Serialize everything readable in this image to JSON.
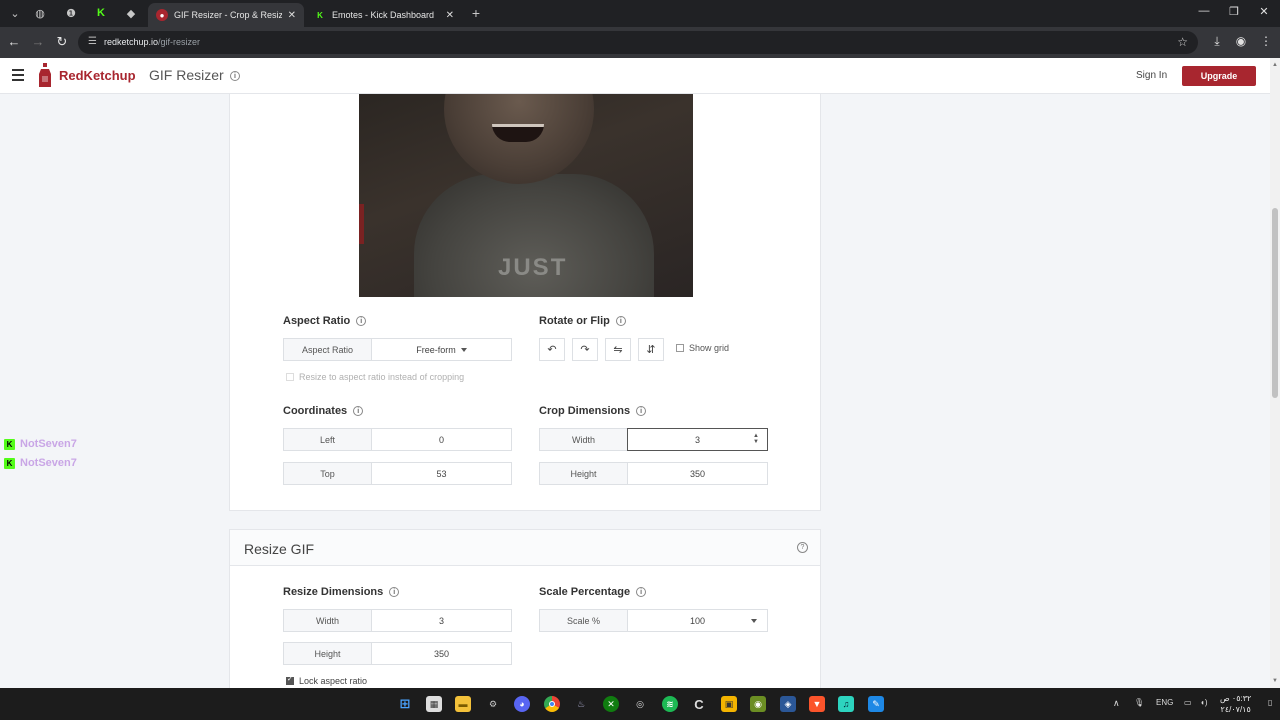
{
  "browser": {
    "tabs": [
      {
        "title": "GIF Resizer - Crop & Resize Ani",
        "active": true
      },
      {
        "title": "Emotes - Kick Dashboard",
        "active": false
      }
    ],
    "url_host": "redketchup.io",
    "url_path": "/gif-resizer"
  },
  "header": {
    "brand": "RedKetchup",
    "app_title": "GIF Resizer",
    "sign_in": "Sign In",
    "upgrade": "Upgrade"
  },
  "preview": {
    "shirt_text": "JUST"
  },
  "aspect": {
    "section_label": "Aspect Ratio",
    "field_label": "Aspect Ratio",
    "value": "Free-form",
    "resize_option": "Resize to aspect ratio instead of cropping"
  },
  "rotate": {
    "section_label": "Rotate or Flip",
    "show_grid": "Show grid"
  },
  "coordinates": {
    "section_label": "Coordinates",
    "left_label": "Left",
    "left_value": "0",
    "top_label": "Top",
    "top_value": "53"
  },
  "crop": {
    "section_label": "Crop Dimensions",
    "width_label": "Width",
    "width_value": "3",
    "height_label": "Height",
    "height_value": "350"
  },
  "resize": {
    "card_title": "Resize GIF",
    "dims_label": "Resize Dimensions",
    "width_label": "Width",
    "width_value": "3",
    "height_label": "Height",
    "height_value": "350",
    "lock_label": "Lock aspect ratio",
    "scale_section_label": "Scale Percentage",
    "scale_label": "Scale %",
    "scale_value": "100"
  },
  "chat": [
    {
      "user": "NotSeven7"
    },
    {
      "user": "NotSeven7"
    }
  ],
  "taskbar": {
    "lang": "ENG",
    "time": "٠٥:٣٢ ص",
    "date": "٢٤/٠٧/١٥"
  },
  "colors": {
    "brand_red": "#a8262f",
    "kick_green": "#53fc18",
    "chat_name": "#c9a6e6"
  }
}
